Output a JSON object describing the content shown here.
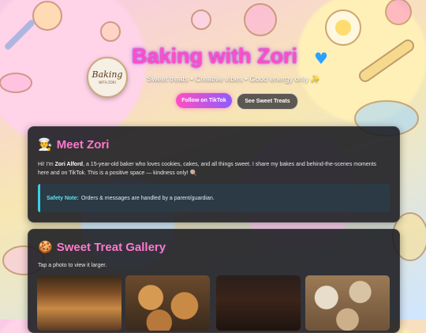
{
  "hero": {
    "logo_text": "Baking",
    "logo_sub": "WITH ZORI",
    "title": "Baking with Zori",
    "tagline": "Sweet treats • Creative vibes • Good energy only ✨",
    "buttons": {
      "tiktok": "Follow on TikTok",
      "sweet": "See Sweet Treats"
    }
  },
  "meet": {
    "icon": "🧑‍🍳",
    "heading": "Meet Zori",
    "intro_pre": "Hi! I'm ",
    "intro_name": "Zori Alford",
    "intro_post": ", a 15-year-old baker who loves cookies, cakes, and all things sweet. I share my bakes and behind-the-scenes moments here and on TikTok. This is a positive space — kindness only! 🍭",
    "safety_label": "Safety Note:",
    "safety_text": "Orders & messages are handled by a parent/guardian."
  },
  "gallery": {
    "icon": "🍪",
    "heading": "Sweet Treat Gallery",
    "hint": "Tap a photo to view it larger."
  }
}
